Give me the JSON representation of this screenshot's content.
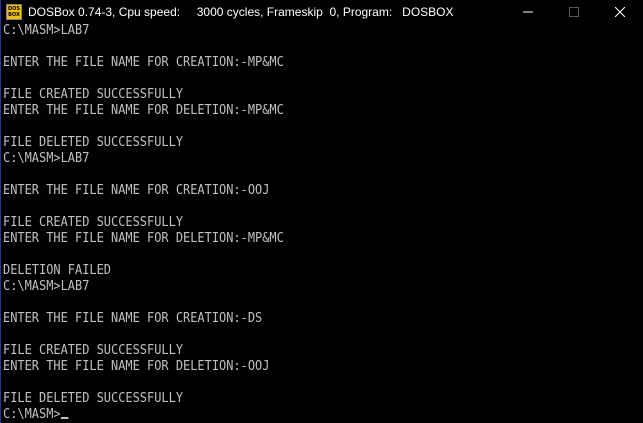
{
  "window": {
    "title": "DOSBox 0.74-3, Cpu speed:     3000 cycles, Frameskip  0, Program:   DOSBOX",
    "icon_text_top": "DOS",
    "icon_text_bottom": "BOX",
    "icons": {
      "app": "dosbox-icon",
      "minimize": "minimize-icon",
      "maximize": "maximize-icon",
      "close": "close-icon"
    }
  },
  "terminal": {
    "lines": [
      "C:\\MASM>LAB7",
      "",
      "ENTER THE FILE NAME FOR CREATION:-MP&MC",
      "",
      "FILE CREATED SUCCESSFULLY",
      "ENTER THE FILE NAME FOR DELETION:-MP&MC",
      "",
      "FILE DELETED SUCCESSFULLY",
      "C:\\MASM>LAB7",
      "",
      "ENTER THE FILE NAME FOR CREATION:-OOJ",
      "",
      "FILE CREATED SUCCESSFULLY",
      "ENTER THE FILE NAME FOR DELETION:-MP&MC",
      "",
      "DELETION FAILED",
      "C:\\MASM>LAB7",
      "",
      "ENTER THE FILE NAME FOR CREATION:-DS",
      "",
      "FILE CREATED SUCCESSFULLY",
      "ENTER THE FILE NAME FOR DELETION:-OOJ",
      "",
      "FILE DELETED SUCCESSFULLY",
      "C:\\MASM>"
    ]
  },
  "colors": {
    "background": "#000000",
    "text": "#c0c0c0",
    "title_text": "#ffffff",
    "icon_bg": "#f0c000"
  }
}
